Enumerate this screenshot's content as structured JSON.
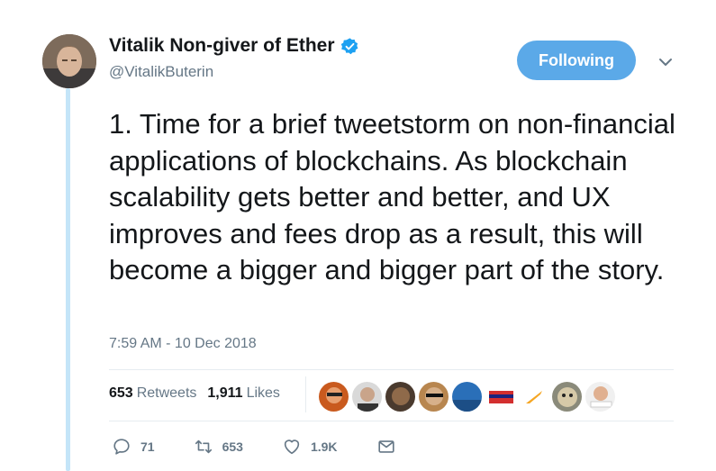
{
  "author": {
    "display_name": "Vitalik Non-giver of Ether",
    "handle": "@VitalikButerin",
    "verified_icon": "verified-badge-icon",
    "avatar": "profile-avatar"
  },
  "follow_button": {
    "label": "Following",
    "color": "#5ba9e8"
  },
  "menu_icon": "chevron-down-icon",
  "tweet": {
    "text": "1. Time for a brief tweetstorm on non-financial applications of blockchains. As blockchain scalability gets better and better, and UX improves and fees drop as a result, this will become a bigger and bigger part of the story.",
    "timestamp": "7:59 AM - 10 Dec 2018"
  },
  "stats": {
    "retweets_count": "653",
    "retweets_label": "Retweets",
    "likes_count": "1,911",
    "likes_label": "Likes"
  },
  "actions": {
    "reply_count": "71",
    "retweet_count": "653",
    "like_count": "1.9K",
    "reply_icon": "reply-icon",
    "retweet_icon": "retweet-icon",
    "like_icon": "heart-icon",
    "message_icon": "envelope-icon"
  },
  "colors": {
    "accent": "#1da1f2",
    "muted_text": "#657786",
    "thread_line": "#c4e5f8"
  }
}
